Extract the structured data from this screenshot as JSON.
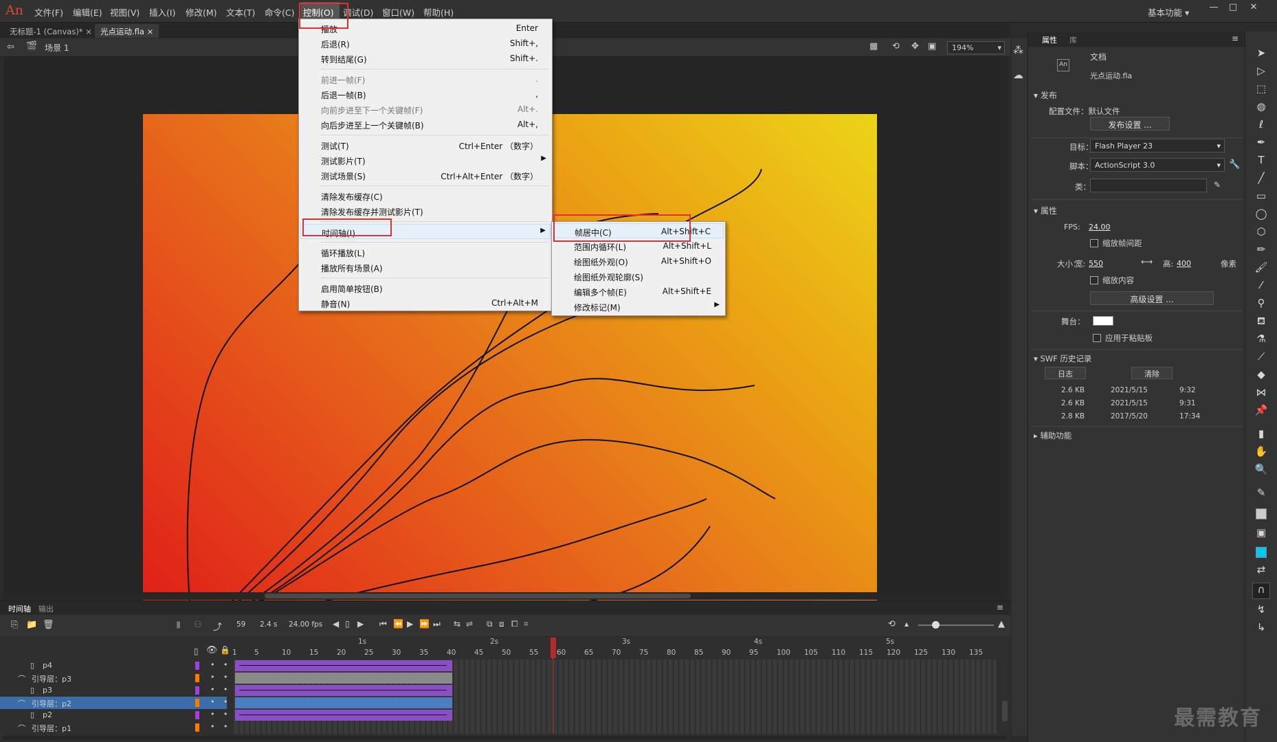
{
  "app": {
    "logo": "An",
    "workspace": "基本功能"
  },
  "menubar": [
    "文件(F)",
    "编辑(E)",
    "视图(V)",
    "插入(I)",
    "修改(M)",
    "文本(T)",
    "命令(C)",
    "控制(O)",
    "调试(D)",
    "窗口(W)",
    "帮助(H)"
  ],
  "tabs": [
    "无标题-1 (Canvas)*",
    "光点运动.fla"
  ],
  "scene": {
    "name": "场景 1",
    "zoom": "194%"
  },
  "control_menu": [
    {
      "label": "播放",
      "shortcut": "Enter"
    },
    {
      "label": "后退(R)",
      "shortcut": "Shift+,"
    },
    {
      "label": "转到结尾(G)",
      "shortcut": "Shift+."
    },
    {
      "label": "前进一帧(F)",
      "shortcut": "."
    },
    {
      "label": "后退一帧(B)",
      "shortcut": ","
    },
    {
      "label": "向前步进至下一个关键帧(F)",
      "shortcut": "Alt+."
    },
    {
      "label": "向后步进至上一个关键帧(B)",
      "shortcut": "Alt+,"
    },
    {
      "label": "测试(T)",
      "shortcut": "Ctrl+Enter （数字）"
    },
    {
      "label": "测试影片(T)",
      "shortcut": ""
    },
    {
      "label": "测试场景(S)",
      "shortcut": "Ctrl+Alt+Enter （数字）"
    },
    {
      "label": "清除发布缓存(C)",
      "shortcut": ""
    },
    {
      "label": "清除发布缓存并测试影片(T)",
      "shortcut": ""
    },
    {
      "label": "时间轴(I)",
      "shortcut": ""
    },
    {
      "label": "循环播放(L)",
      "shortcut": ""
    },
    {
      "label": "播放所有场景(A)",
      "shortcut": ""
    },
    {
      "label": "启用简单按钮(B)",
      "shortcut": ""
    },
    {
      "label": "静音(N)",
      "shortcut": "Ctrl+Alt+M"
    }
  ],
  "timeline_submenu": [
    {
      "label": "帧居中(C)",
      "shortcut": "Alt+Shift+C"
    },
    {
      "label": "范围内循环(L)",
      "shortcut": "Alt+Shift+L"
    },
    {
      "label": "绘图纸外观(O)",
      "shortcut": "Alt+Shift+O"
    },
    {
      "label": "绘图纸外观轮廓(S)",
      "shortcut": ""
    },
    {
      "label": "编辑多个帧(E)",
      "shortcut": "Alt+Shift+E"
    },
    {
      "label": "修改标记(M)",
      "shortcut": ""
    }
  ],
  "properties": {
    "tabs": [
      "属性",
      "库"
    ],
    "doc_label": "文档",
    "doc_name": "光点运动.fla",
    "publish": "发布",
    "profile": "配置文件：默认文件",
    "publish_settings": "发布设置 ...",
    "target_label": "目标：",
    "target": "Flash Player 23",
    "script_label": "脚本：",
    "script": "ActionScript 3.0",
    "class_label": "类：",
    "attrs": "属性",
    "fps_label": "FPS:",
    "fps": "24.00",
    "scale_spacing": "缩放帧间距",
    "size_label": "大小：",
    "width_label": "宽:",
    "width": "550",
    "height_label": "高:",
    "height": "400",
    "unit": "像素",
    "scale_content": "缩放内容",
    "advanced": "高级设置 ...",
    "stage_label": "舞台：",
    "stage_color": "#ffffff",
    "clipboard": "应用于粘贴板",
    "swf_history": "SWF 历史记录",
    "log": "日志",
    "clear": "清除",
    "history": [
      [
        "2.6 KB",
        "2021/5/15",
        "9:32"
      ],
      [
        "2.6 KB",
        "2021/5/15",
        "9:31"
      ],
      [
        "2.8 KB",
        "2017/5/20",
        "17:34"
      ]
    ],
    "accessibility": "辅助功能"
  },
  "timeline": {
    "tabs": [
      "时间轴",
      "输出"
    ],
    "frame": "59",
    "time": "2.4 s",
    "fps": "24.00 fps",
    "seconds": [
      "1s",
      "2s",
      "3s",
      "4s",
      "5s"
    ],
    "ticks": [
      "1",
      "5",
      "10",
      "15",
      "20",
      "25",
      "30",
      "35",
      "40",
      "45",
      "50",
      "55",
      "60",
      "65",
      "70",
      "75",
      "80",
      "85",
      "90",
      "95",
      "100",
      "105",
      "110",
      "115",
      "120",
      "125",
      "130",
      "135"
    ],
    "layers": [
      {
        "name": "p4",
        "guide": false,
        "color": "#a040e0"
      },
      {
        "name": "引导层：p3",
        "guide": true,
        "color": "#ff7a00"
      },
      {
        "name": "p3",
        "guide": false,
        "color": "#a040e0"
      },
      {
        "name": "引导层：p2",
        "guide": true,
        "color": "#ff7a00"
      },
      {
        "name": "p2",
        "guide": false,
        "color": "#a040e0"
      },
      {
        "name": "引导层：p1",
        "guide": true,
        "color": "#ff7a00"
      }
    ]
  },
  "watermark": "最需教育"
}
